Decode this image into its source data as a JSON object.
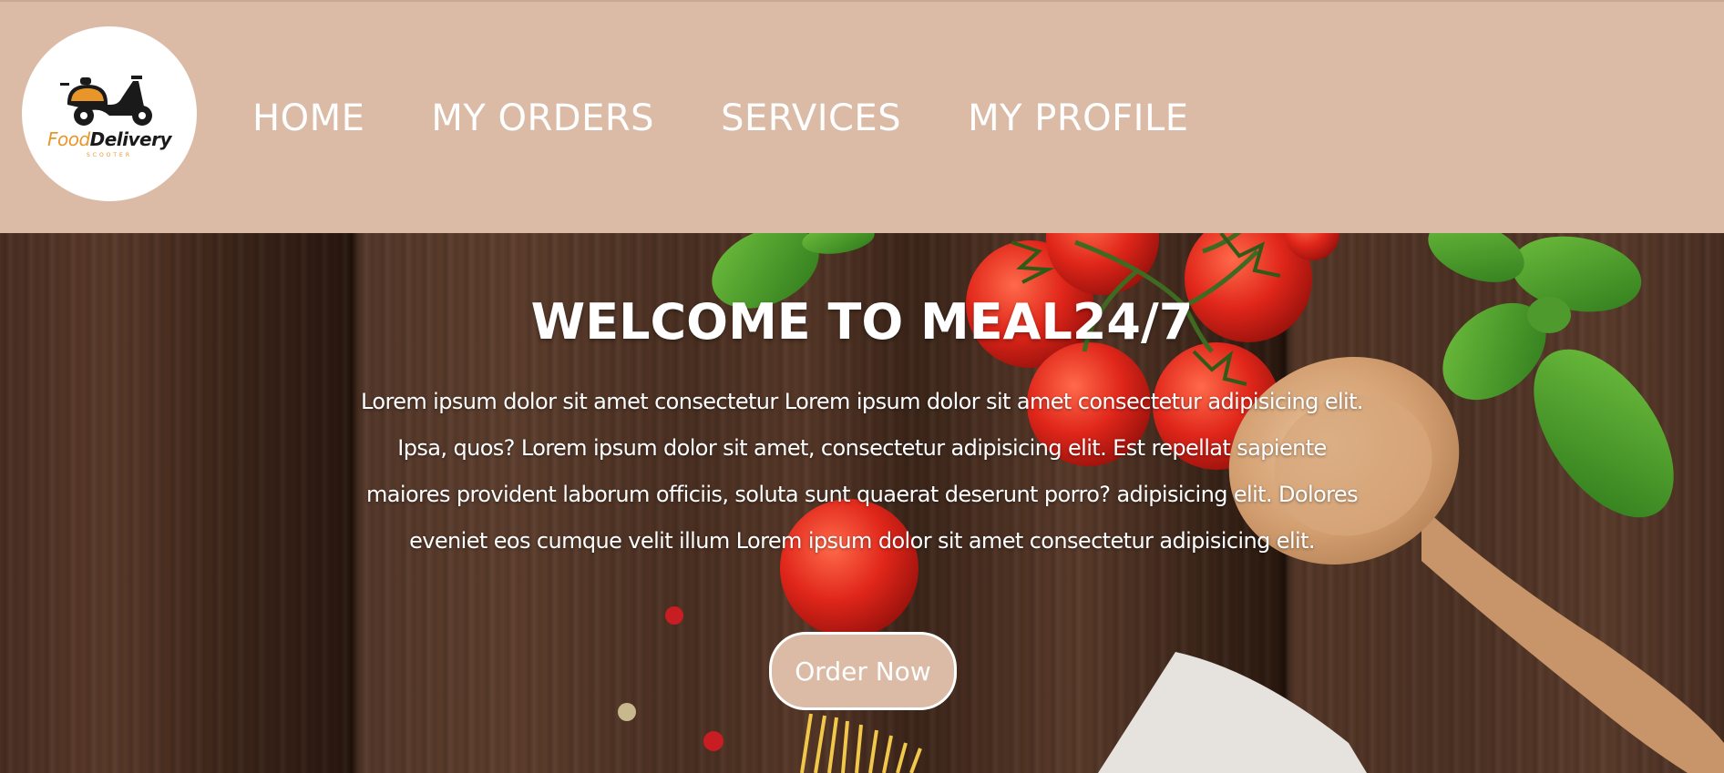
{
  "header": {
    "logo": {
      "text_food": "Food",
      "text_delivery": "Delivery",
      "subtext": "SCOOTER",
      "icon": "scooter-icon"
    },
    "nav": [
      {
        "label": "HOME"
      },
      {
        "label": "MY ORDERS"
      },
      {
        "label": "SERVICES"
      },
      {
        "label": "MY PROFILE"
      }
    ],
    "background_color": "#dbbba6"
  },
  "hero": {
    "title": "WELCOME TO MEAL24/7",
    "paragraph": "Lorem ipsum dolor sit amet consectetur Lorem ipsum dolor sit amet consectetur adipisicing elit. Ipsa, quos? Lorem ipsum dolor sit amet, consectetur adipisicing elit. Est repellat sapiente maiores provident laborum officiis, soluta sunt quaerat deserunt porro? adipisicing elit. Dolores eveniet eos cumque velit illum Lorem ipsum dolor sit amet consectetur adipisicing elit.",
    "button_label": "Order Now",
    "background": "wooden-table-with-tomatoes-basil-spoon"
  },
  "colors": {
    "accent": "#dbbba6",
    "text": "#ffffff"
  }
}
